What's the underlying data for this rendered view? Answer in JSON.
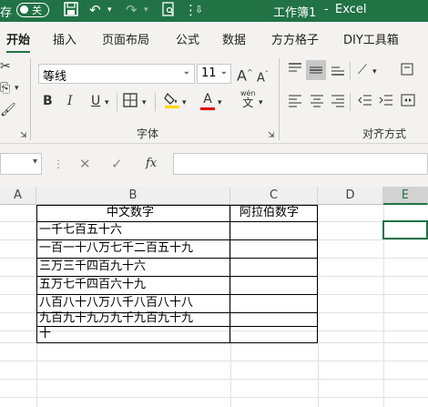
{
  "titlebar": {
    "save_prefix": "存",
    "autosave_state": "关",
    "title": "工作簿1",
    "separator": "-",
    "app": "Excel",
    "bg_color": "#217346"
  },
  "tabs": [
    "开始",
    "插入",
    "页面布局",
    "公式",
    "数据",
    "方方格子",
    "DIY工具箱"
  ],
  "ribbon": {
    "font_name": "等线",
    "font_size": "11",
    "grow_font": "A",
    "shrink_font": "A",
    "bold": "B",
    "italic": "I",
    "underline": "U",
    "font_color_letter": "A",
    "phonetic_top": "wén",
    "phonetic_bottom": "文",
    "font_group_label": "字体",
    "align_group_label": "对齐方式",
    "fill_color": "#ffd700",
    "font_color": "#e00000"
  },
  "formula_bar": {
    "fx": "fx",
    "value": ""
  },
  "columns": [
    "A",
    "B",
    "C",
    "D",
    "E"
  ],
  "table": {
    "headers": [
      "中文数字",
      "阿拉伯数字"
    ],
    "rows": [
      "一千七百五十六",
      "一百一十八万七千二百五十九",
      "三万三千四百九十六",
      "五万七千四百六十九",
      "八百八十八万八千八百八十八",
      "九百九十九万九千九百九十九",
      "十"
    ]
  },
  "selection_color": "#217346"
}
